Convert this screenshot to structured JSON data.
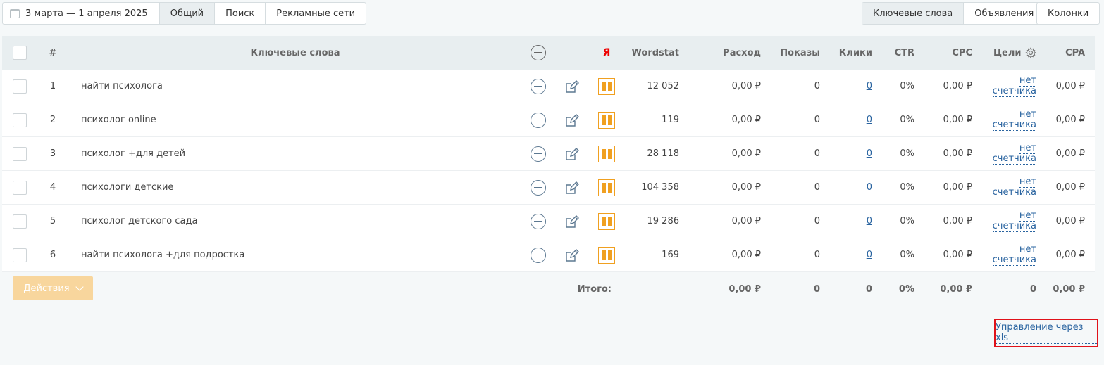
{
  "toolbar": {
    "date_range": "3 марта — 1 апреля 2025",
    "filter_tabs": [
      "Общий",
      "Поиск",
      "Рекламные сети"
    ],
    "view_tabs": [
      "Ключевые слова",
      "Объявления"
    ],
    "columns_label": "Колонки"
  },
  "table": {
    "headers": {
      "num": "#",
      "keywords": "Ключевые слова",
      "ya": "Я",
      "wordstat": "Wordstat",
      "expense": "Расход",
      "impressions": "Показы",
      "clicks": "Клики",
      "ctr": "CTR",
      "cpc": "CPC",
      "goals": "Цели",
      "cpa": "CPA"
    },
    "rows": [
      {
        "num": "1",
        "keyword": "найти психолога",
        "wordstat": "12 052",
        "expense": "0,00 ₽",
        "impressions": "0",
        "clicks": "0",
        "ctr": "0%",
        "cpc": "0,00 ₽",
        "goals_1": "нет",
        "goals_2": "счетчика",
        "cpa": "0,00 ₽"
      },
      {
        "num": "2",
        "keyword": "психолог online",
        "wordstat": "119",
        "expense": "0,00 ₽",
        "impressions": "0",
        "clicks": "0",
        "ctr": "0%",
        "cpc": "0,00 ₽",
        "goals_1": "нет",
        "goals_2": "счетчика",
        "cpa": "0,00 ₽"
      },
      {
        "num": "3",
        "keyword": "психолог +для детей",
        "wordstat": "28 118",
        "expense": "0,00 ₽",
        "impressions": "0",
        "clicks": "0",
        "ctr": "0%",
        "cpc": "0,00 ₽",
        "goals_1": "нет",
        "goals_2": "счетчика",
        "cpa": "0,00 ₽"
      },
      {
        "num": "4",
        "keyword": "психологи детские",
        "wordstat": "104 358",
        "expense": "0,00 ₽",
        "impressions": "0",
        "clicks": "0",
        "ctr": "0%",
        "cpc": "0,00 ₽",
        "goals_1": "нет",
        "goals_2": "счетчика",
        "cpa": "0,00 ₽"
      },
      {
        "num": "5",
        "keyword": "психолог детского сада",
        "wordstat": "19 286",
        "expense": "0,00 ₽",
        "impressions": "0",
        "clicks": "0",
        "ctr": "0%",
        "cpc": "0,00 ₽",
        "goals_1": "нет",
        "goals_2": "счетчика",
        "cpa": "0,00 ₽"
      },
      {
        "num": "6",
        "keyword": "найти психолога +для подростка",
        "wordstat": "169",
        "expense": "0,00 ₽",
        "impressions": "0",
        "clicks": "0",
        "ctr": "0%",
        "cpc": "0,00 ₽",
        "goals_1": "нет",
        "goals_2": "счетчика",
        "cpa": "0,00 ₽"
      }
    ],
    "totals": {
      "label": "Итого:",
      "expense": "0,00 ₽",
      "impressions": "0",
      "clicks": "0",
      "ctr": "0%",
      "cpc": "0,00 ₽",
      "goals": "0",
      "cpa": "0,00 ₽"
    },
    "actions_label": "Действия"
  },
  "xls_link": "Управление через xls",
  "colors": {
    "accent_orange": "#f0a020",
    "actions_button": "#f8d69d",
    "link": "#2a64a0",
    "yandex_red": "#e00000",
    "highlight_box": "#e0121a"
  }
}
